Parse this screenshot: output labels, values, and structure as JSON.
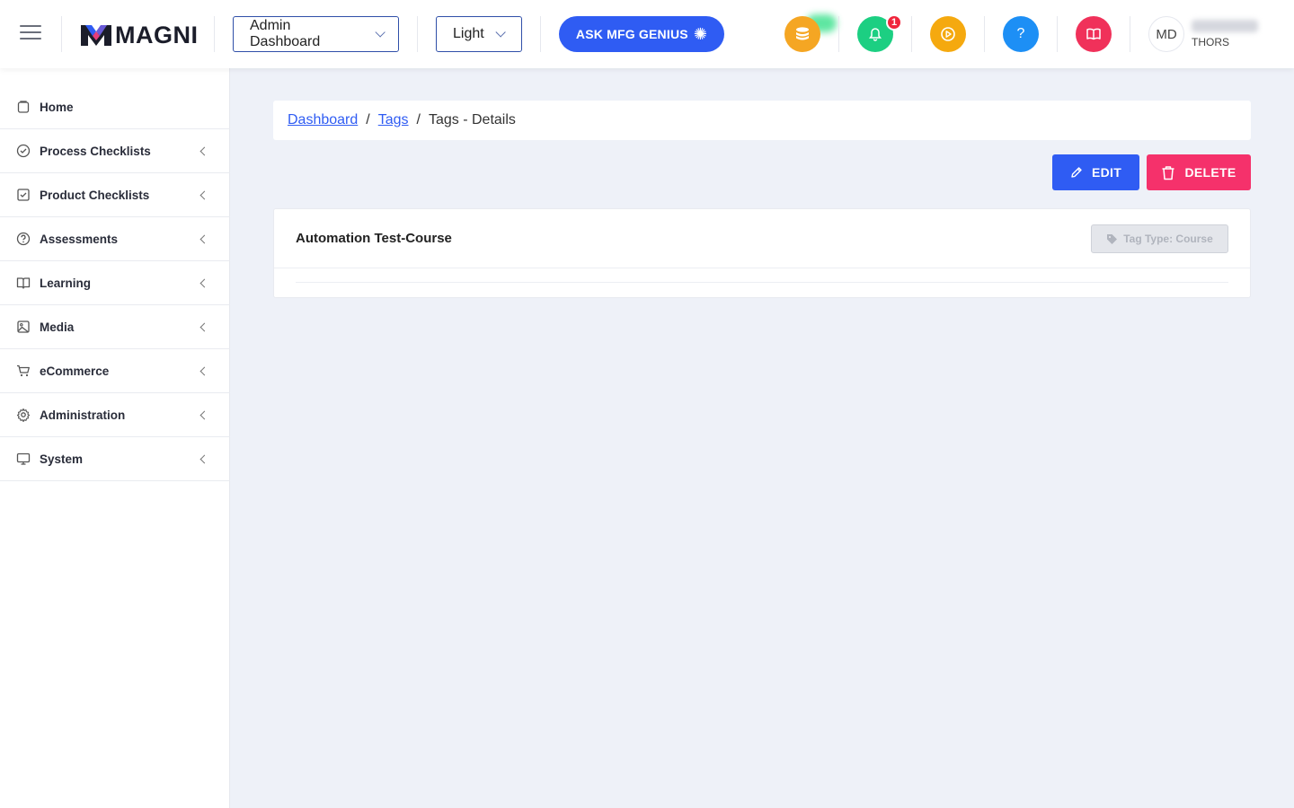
{
  "header": {
    "logo_text": "MAGNI",
    "dashboard_select": "Admin Dashboard",
    "theme_select": "Light",
    "ask_button": "ASK MFG GENIUS",
    "notification_count": "1",
    "help_label": "?",
    "user_initials": "MD",
    "user_org": "THORS"
  },
  "sidebar": {
    "items": [
      {
        "label": "Home",
        "icon": "home-icon"
      },
      {
        "label": "Process Checklists",
        "icon": "check-circle-icon"
      },
      {
        "label": "Product Checklists",
        "icon": "check-square-icon"
      },
      {
        "label": "Assessments",
        "icon": "question-circle-icon"
      },
      {
        "label": "Learning",
        "icon": "book-open-icon"
      },
      {
        "label": "Media",
        "icon": "image-icon"
      },
      {
        "label": "eCommerce",
        "icon": "cart-icon"
      },
      {
        "label": "Administration",
        "icon": "gear-icon"
      },
      {
        "label": "System",
        "icon": "monitor-icon"
      }
    ]
  },
  "breadcrumb": {
    "items": [
      "Dashboard",
      "Tags",
      "Tags - Details"
    ]
  },
  "actions": {
    "edit_label": "EDIT",
    "delete_label": "DELETE"
  },
  "card": {
    "title": "Automation Test-Course",
    "tag_type": "Tag Type: Course"
  },
  "colors": {
    "primary": "#2f5cf3",
    "danger": "#f5316b",
    "coins": "#f5a623",
    "notifications": "#1ccf82",
    "video": "#f5a90f",
    "help": "#1d8ff5",
    "guide": "#f0315a"
  }
}
